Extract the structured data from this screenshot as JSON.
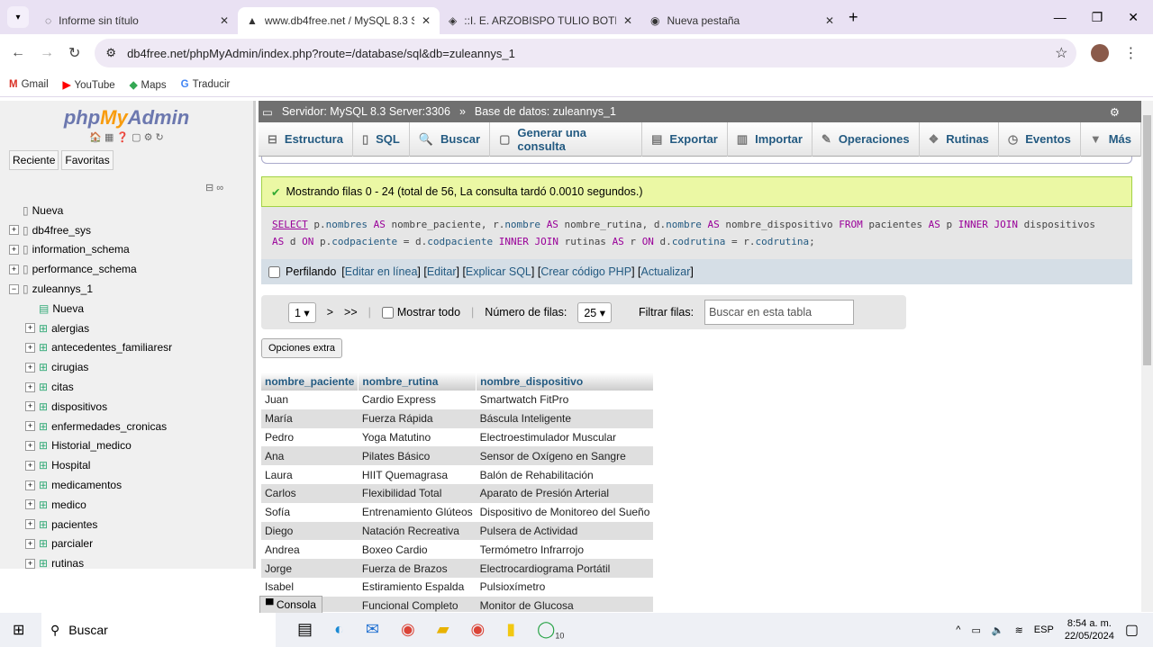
{
  "browser": {
    "tabs": [
      {
        "title": "Informe sin título",
        "active": false
      },
      {
        "title": "www.db4free.net / MySQL 8.3 S",
        "active": true
      },
      {
        "title": "::I. E. ARZOBISPO TULIO BOTER",
        "active": false
      },
      {
        "title": "Nueva pestaña",
        "active": false
      }
    ],
    "url": "db4free.net/phpMyAdmin/index.php?route=/database/sql&db=zuleannys_1",
    "bookmarks": [
      "Gmail",
      "YouTube",
      "Maps",
      "Traducir"
    ]
  },
  "sidebar": {
    "logo": "phpMyAdmin",
    "buttons": [
      "Reciente",
      "Favoritas"
    ],
    "tree": [
      {
        "label": "Nueva",
        "level": 0
      },
      {
        "label": "db4free_sys",
        "level": 0
      },
      {
        "label": "information_schema",
        "level": 0
      },
      {
        "label": "performance_schema",
        "level": 0
      },
      {
        "label": "zuleannys_1",
        "level": 0
      },
      {
        "label": "Nueva",
        "level": 1
      },
      {
        "label": "alergias",
        "level": 1
      },
      {
        "label": "antecedentes_familiaresr",
        "level": 1
      },
      {
        "label": "cirugias",
        "level": 1
      },
      {
        "label": "citas",
        "level": 1
      },
      {
        "label": "dispositivos",
        "level": 1
      },
      {
        "label": "enfermedades_cronicas",
        "level": 1
      },
      {
        "label": "Historial_medico",
        "level": 1
      },
      {
        "label": "Hospital",
        "level": 1
      },
      {
        "label": "medicamentos",
        "level": 1
      },
      {
        "label": "medico",
        "level": 1
      },
      {
        "label": "pacientes",
        "level": 1
      },
      {
        "label": "parcialer",
        "level": 1
      },
      {
        "label": "rutinas",
        "level": 1
      }
    ]
  },
  "breadcrumb": {
    "server": "Servidor: MySQL 8.3 Server:3306",
    "sep": "»",
    "database": "Base de datos: zuleannys_1"
  },
  "menu": [
    "Estructura",
    "SQL",
    "Buscar",
    "Generar una consulta",
    "Exportar",
    "Importar",
    "Operaciones",
    "Rutinas",
    "Eventos",
    "Más"
  ],
  "message": "Mostrando filas 0 - 24 (total de 56, La consulta tardó 0.0010 segundos.)",
  "profiling": {
    "label": "Perfilando",
    "links": [
      "Editar en línea",
      "Editar",
      "Explicar SQL",
      "Crear código PHP",
      "Actualizar"
    ]
  },
  "nav": {
    "page": "1",
    "next": ">",
    "last": ">>",
    "show_all": "Mostrar todo",
    "rows_label": "Número de filas:",
    "rows": "25",
    "filter_label": "Filtrar filas:",
    "filter_placeholder": "Buscar en esta tabla"
  },
  "extra_options": "Opciones extra",
  "table": {
    "columns": [
      "nombre_paciente",
      "nombre_rutina",
      "nombre_dispositivo"
    ],
    "rows": [
      [
        "Juan",
        "Cardio Express",
        "Smartwatch FitPro"
      ],
      [
        "María",
        "Fuerza Rápida",
        "Báscula Inteligente"
      ],
      [
        "Pedro",
        "Yoga Matutino",
        "Electroestimulador Muscular"
      ],
      [
        "Ana",
        "Pilates Básico",
        "Sensor de Oxígeno en Sangre"
      ],
      [
        "Laura",
        "HIIT Quemagrasa",
        "Balón de Rehabilitación"
      ],
      [
        "Carlos",
        "Flexibilidad Total",
        "Aparato de Presión Arterial"
      ],
      [
        "Sofía",
        "Entrenamiento Glúteos",
        "Dispositivo de Monitoreo del Sueño"
      ],
      [
        "Diego",
        "Natación Recreativa",
        "Pulsera de Actividad"
      ],
      [
        "Andrea",
        "Boxeo Cardio",
        "Termómetro Infrarrojo"
      ],
      [
        "Jorge",
        "Fuerza de Brazos",
        "Electrocardiograma Portátil"
      ],
      [
        "Isabel",
        "Estiramiento Espalda",
        "Pulsioxímetro"
      ],
      [
        "",
        "Funcional Completo",
        "Monitor de Glucosa"
      ]
    ]
  },
  "console": "Consola",
  "taskbar": {
    "search": "Buscar",
    "lang": "ESP",
    "time": "8:54 a. m.",
    "date": "22/05/2024",
    "whatsapp_badge": "10"
  }
}
